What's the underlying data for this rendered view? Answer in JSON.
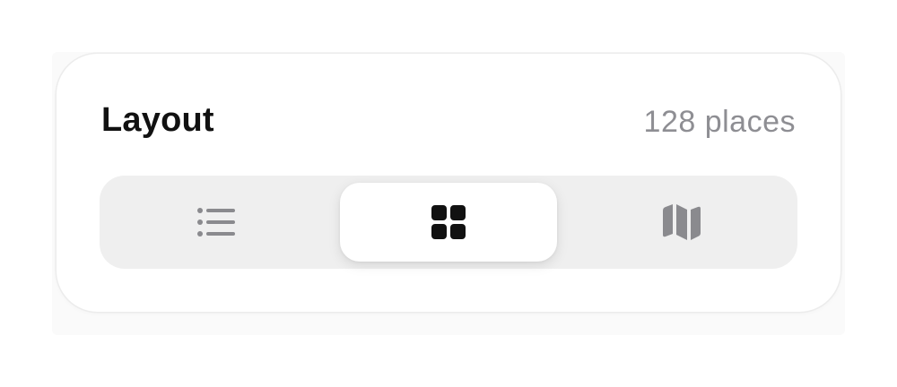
{
  "layout_card": {
    "title": "Layout",
    "count_label": "128 places"
  },
  "view_switcher": {
    "selected": "grid",
    "options": [
      {
        "id": "list",
        "icon": "list-icon",
        "selected": false
      },
      {
        "id": "grid",
        "icon": "grid-icon",
        "selected": true
      },
      {
        "id": "map",
        "icon": "map-icon",
        "selected": false
      }
    ],
    "colors": {
      "selected_icon": "#111111",
      "unselected_icon": "#8a8a8e",
      "track": "#efefef",
      "pill": "#ffffff"
    }
  }
}
